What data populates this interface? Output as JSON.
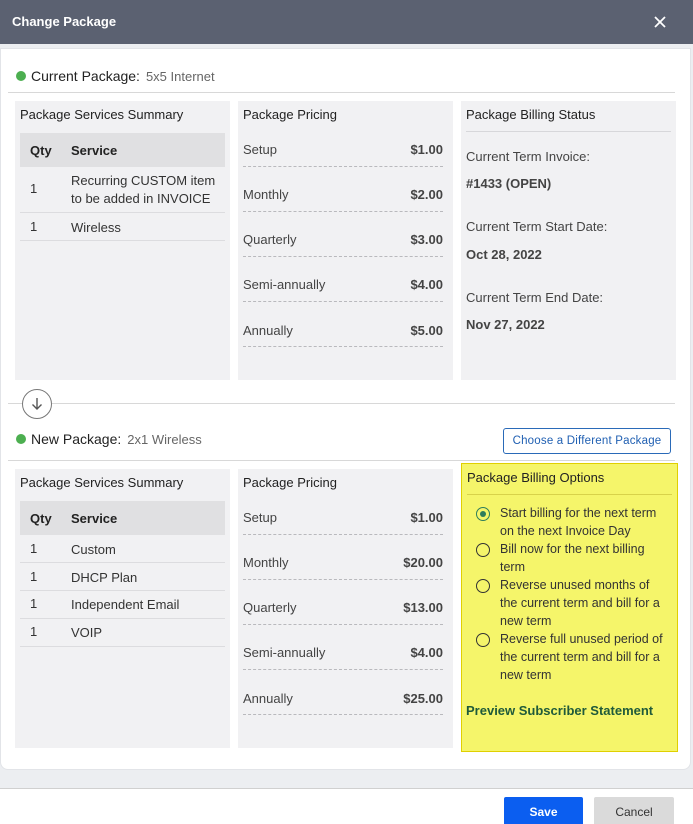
{
  "dialog": {
    "title": "Change Package",
    "close_icon": "close-icon"
  },
  "current_package": {
    "label": "Current Package:",
    "name": "5x5 Internet",
    "status_color": "#4caf50",
    "services": {
      "title": "Package Services Summary",
      "col_qty": "Qty",
      "col_service": "Service",
      "rows": [
        {
          "qty": "1",
          "service": "Recurring CUSTOM item to be added in INVOICE"
        },
        {
          "qty": "1",
          "service": "Wireless"
        }
      ]
    },
    "pricing": {
      "title": "Package Pricing",
      "rows": [
        {
          "label": "Setup",
          "value": "$1.00"
        },
        {
          "label": "Monthly",
          "value": "$2.00"
        },
        {
          "label": "Quarterly",
          "value": "$3.00"
        },
        {
          "label": "Semi-annually",
          "value": "$4.00"
        },
        {
          "label": "Annually",
          "value": "$5.00"
        }
      ]
    },
    "billing_status": {
      "title": "Package Billing Status",
      "invoice_label": "Current Term Invoice:",
      "invoice_value": "#1433 (OPEN)",
      "start_label": "Current Term Start Date:",
      "start_value": "Oct 28, 2022",
      "end_label": "Current Term End Date:",
      "end_value": "Nov 27, 2022"
    }
  },
  "divider_icon": "arrow-down-circle-icon",
  "new_package": {
    "label": "New Package:",
    "name": "2x1 Wireless",
    "status_color": "#4caf50",
    "choose_button": "Choose a Different Package",
    "services": {
      "title": "Package Services Summary",
      "col_qty": "Qty",
      "col_service": "Service",
      "rows": [
        {
          "qty": "1",
          "service": "Custom"
        },
        {
          "qty": "1",
          "service": "DHCP Plan"
        },
        {
          "qty": "1",
          "service": "Independent Email"
        },
        {
          "qty": "1",
          "service": "VOIP"
        }
      ]
    },
    "pricing": {
      "title": "Package Pricing",
      "rows": [
        {
          "label": "Setup",
          "value": "$1.00"
        },
        {
          "label": "Monthly",
          "value": "$20.00"
        },
        {
          "label": "Quarterly",
          "value": "$13.00"
        },
        {
          "label": "Semi-annually",
          "value": "$4.00"
        },
        {
          "label": "Annually",
          "value": "$25.00"
        }
      ]
    },
    "billing_options": {
      "title": "Package Billing Options",
      "highlight_color": "#f5f56a",
      "selected_index": 0,
      "options": [
        "Start billing for the next term on the next Invoice Day",
        "Bill now for the next billing term",
        "Reverse unused months of the current term and bill for a new term",
        "Reverse full unused period of the current term and bill for a new term"
      ],
      "preview_link": "Preview Subscriber Statement"
    }
  },
  "footer": {
    "save_label": "Save",
    "cancel_label": "Cancel",
    "save_color": "#0b5ef0"
  }
}
